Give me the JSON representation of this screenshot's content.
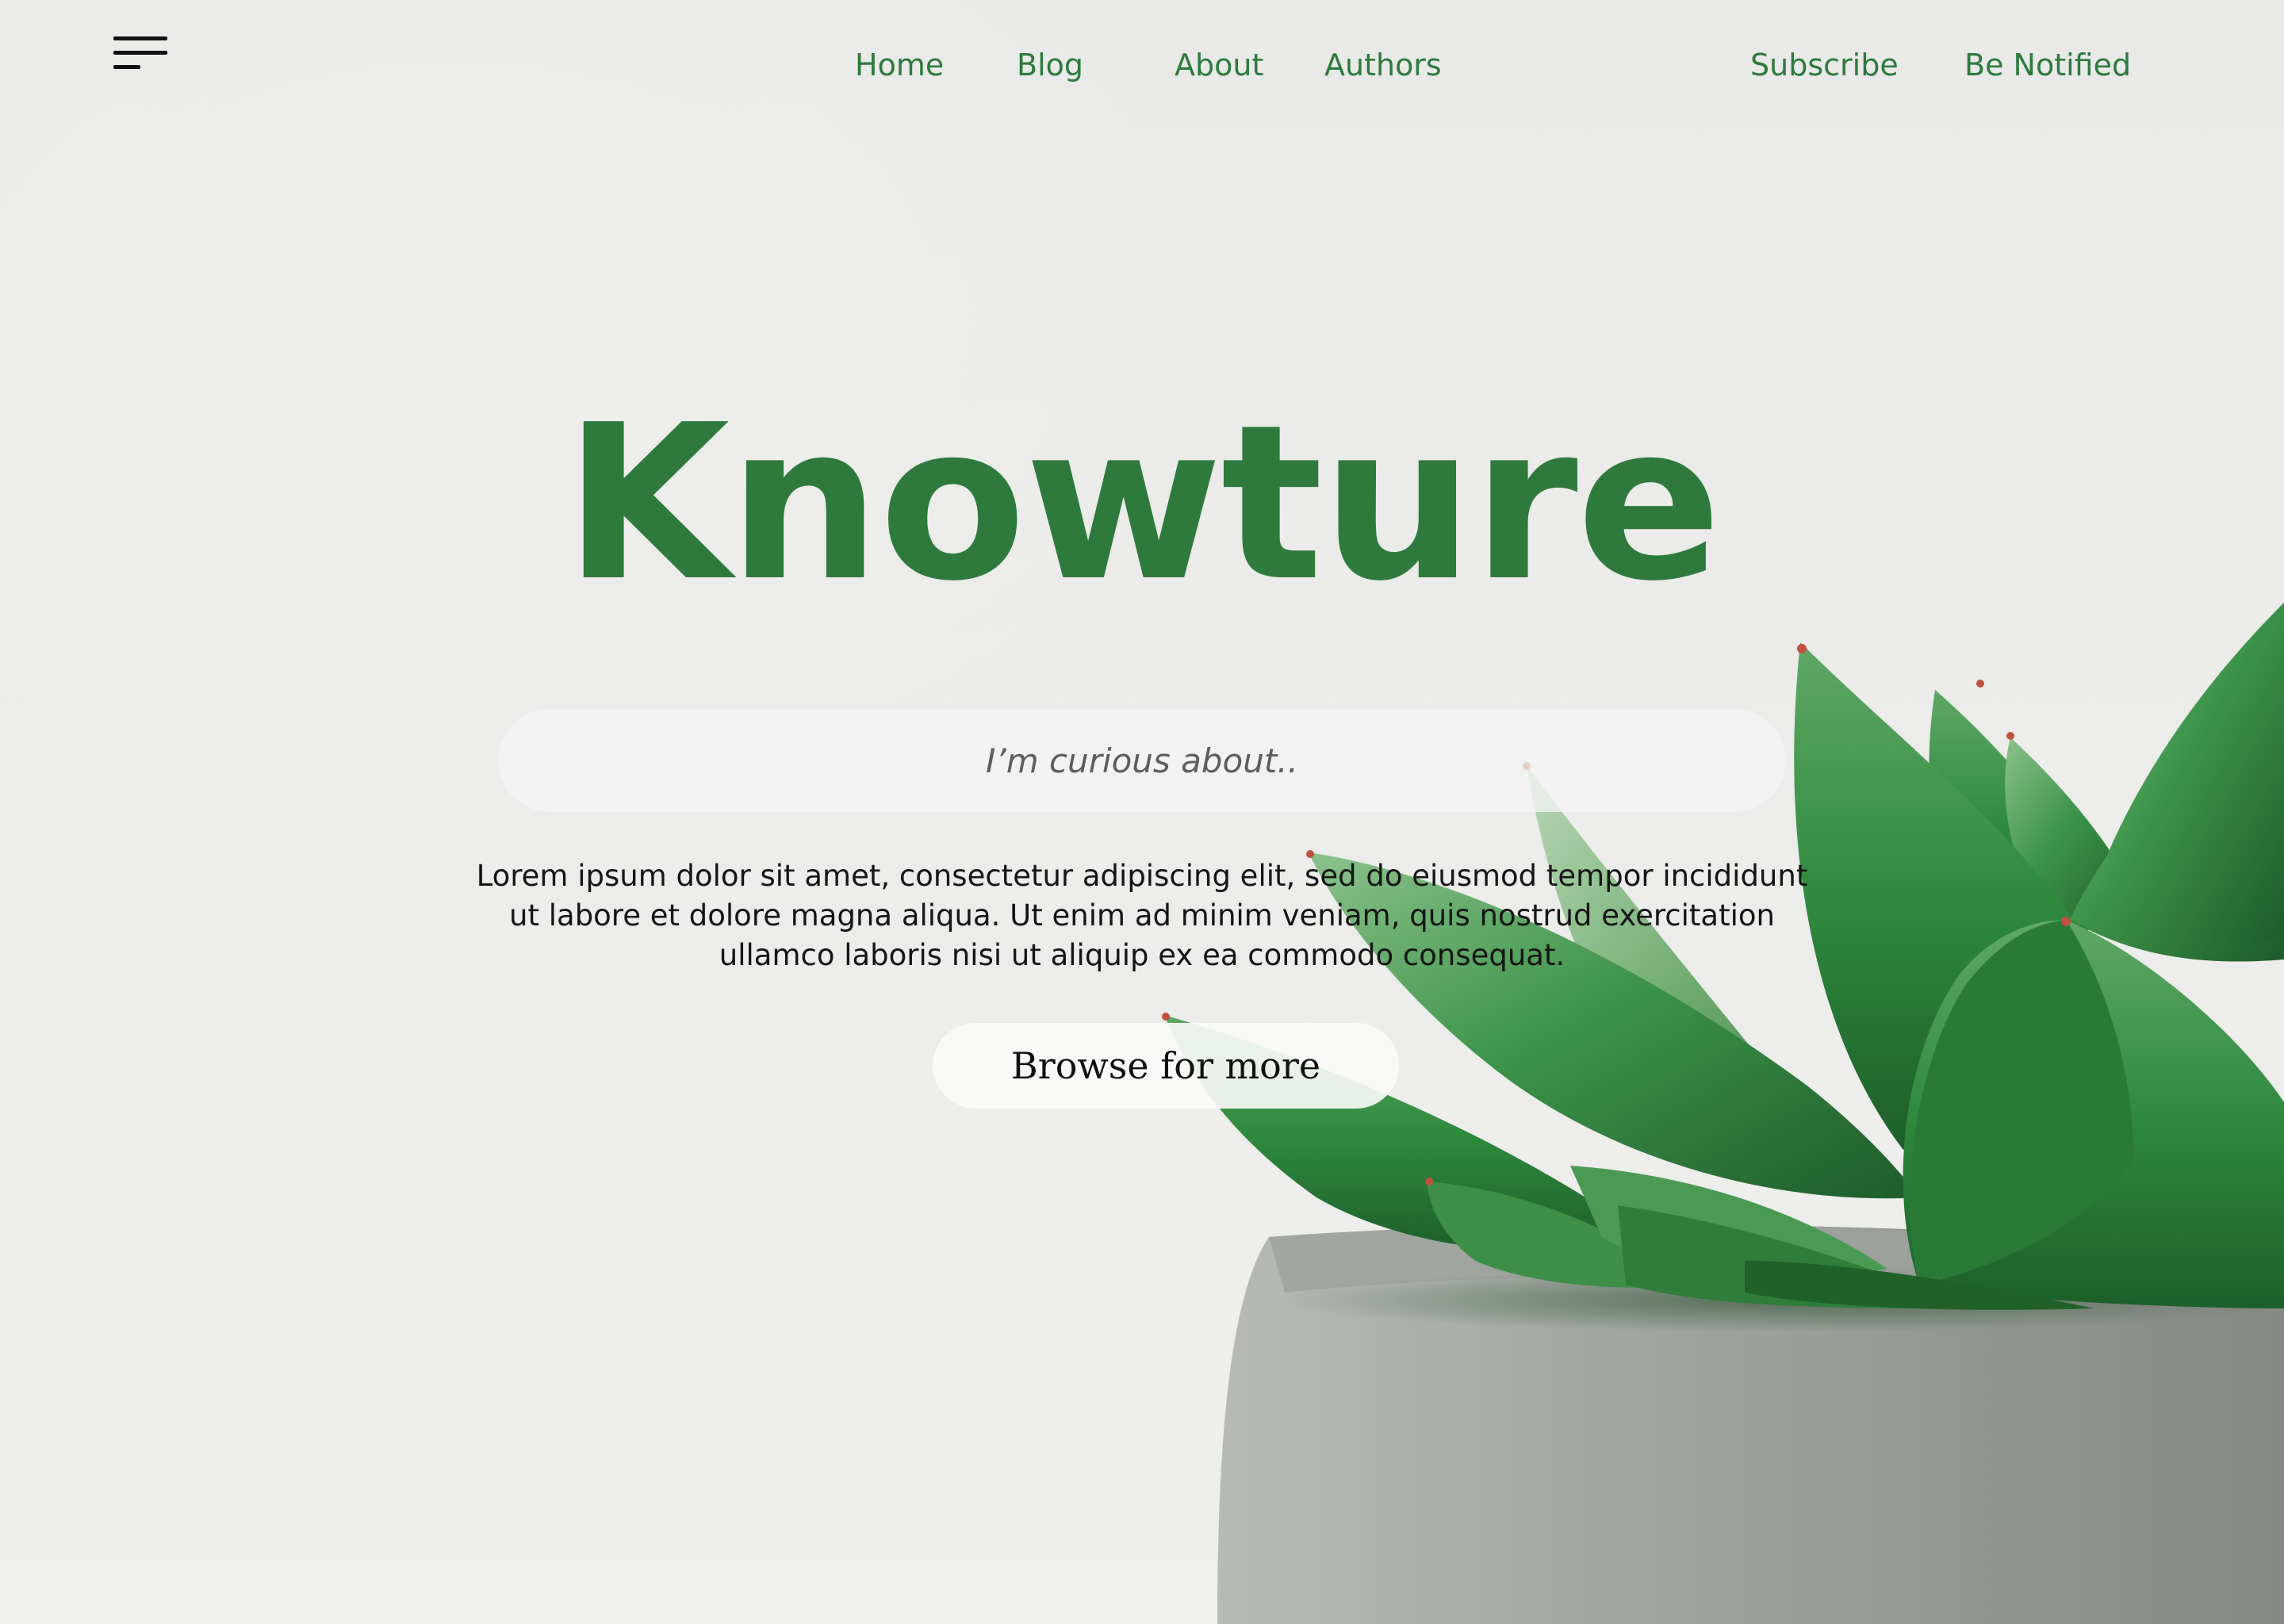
{
  "nav": {
    "menu_icon": "hamburger-menu-icon",
    "links": [
      "Home",
      "Blog",
      "About",
      "Authors"
    ],
    "subscribe": "Subscribe",
    "be_notified": "Be Notified"
  },
  "hero": {
    "title": "Knowture",
    "search_placeholder": "I’m curious about..",
    "intro": "Lorem ipsum dolor sit amet, consectetur adipiscing elit, sed do eiusmod tempor incididunt ut labore et dolore magna aliqua. Ut enim ad minim veniam, quis nostrud exercitation ullamco laboris nisi ut aliquip ex ea commodo consequat.",
    "cta": "Browse for more"
  },
  "colors": {
    "brand_green": "#2e7a3d",
    "background": "#ebebe9",
    "text_dark": "#151515"
  }
}
